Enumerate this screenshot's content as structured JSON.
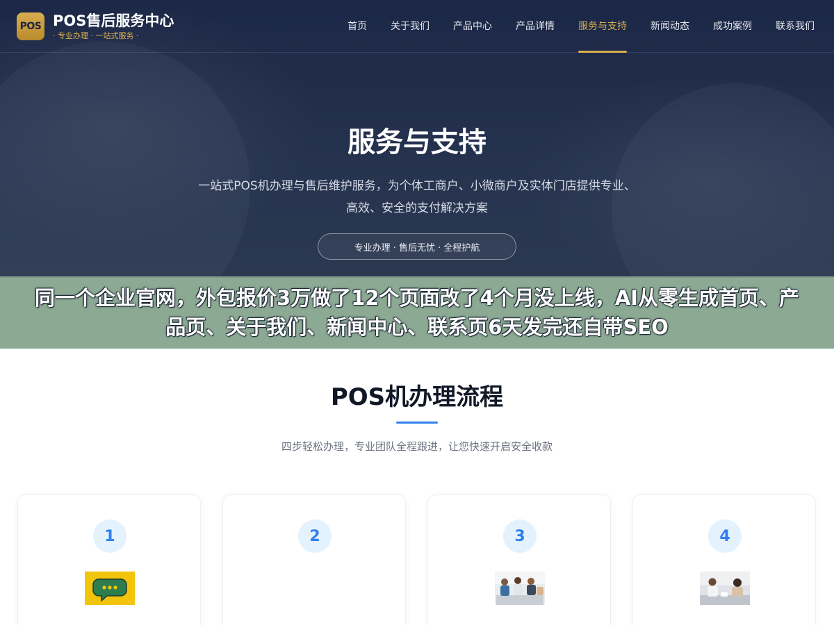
{
  "brand": {
    "logo_text": "POS",
    "title": "POS售后服务中心",
    "subtitle": "· 专业办理 · 一站式服务 ·"
  },
  "nav": {
    "items": [
      {
        "label": "首页"
      },
      {
        "label": "关于我们"
      },
      {
        "label": "产品中心"
      },
      {
        "label": "产品详情"
      },
      {
        "label": "服务与支持",
        "active": true
      },
      {
        "label": "新闻动态"
      },
      {
        "label": "成功案例"
      },
      {
        "label": "联系我们"
      }
    ]
  },
  "hero": {
    "title": "服务与支持",
    "description": "一站式POS机办理与售后维护服务，为个体工商户、小微商户及实体门店提供专业、高效、安全的支付解决方案",
    "pill": "专业办理 · 售后无忧 · 全程护航"
  },
  "banner": {
    "text": "同一个企业官网，外包报价3万做了12个页面改了4个月没上线，AI从零生成首页、产品页、关于我们、新闻中心、联系页6天发完还自带SEO"
  },
  "process": {
    "title": "POS机办理流程",
    "subtitle": "四步轻松办理，专业团队全程跟进，让您快速开启安全收款",
    "steps": [
      {
        "number": "1",
        "image": "chat-bubble-icon"
      },
      {
        "number": "2",
        "image": ""
      },
      {
        "number": "3",
        "image": "team-meeting-photo"
      },
      {
        "number": "4",
        "image": "consultation-photo"
      }
    ]
  },
  "colors": {
    "hero_bg": "#1b2746",
    "accent_gold": "#d9ae50",
    "accent_blue": "#2f80ed",
    "banner_bg": "#83a28b"
  }
}
